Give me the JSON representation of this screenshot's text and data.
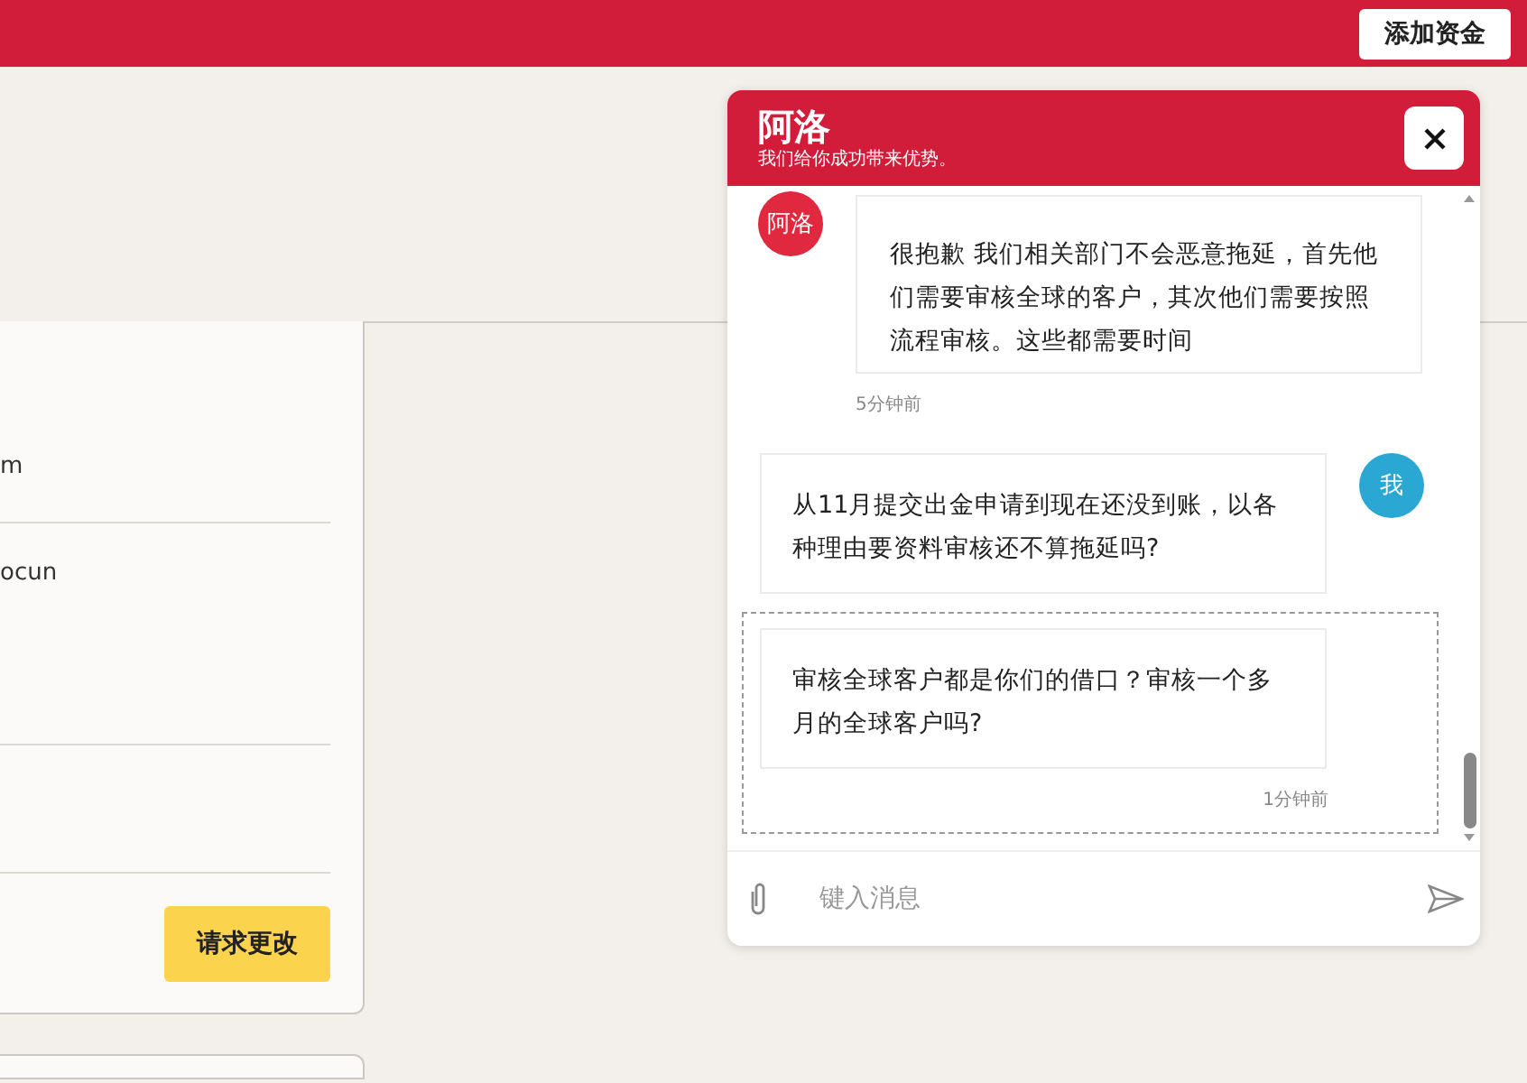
{
  "top_bar": {
    "button": "添加资金"
  },
  "card": {
    "rows": [
      {
        "text": "m"
      },
      {
        "text": "ocun"
      },
      {
        "text": ""
      }
    ],
    "button": "请求更改"
  },
  "chat": {
    "title": "阿洛",
    "subtitle": "我们给你成功带来优势。",
    "messages": [
      {
        "kind": "agent",
        "avatar": "阿洛",
        "text": "很抱歉 我们相关部门不会恶意拖延，首先他们需要审核全球的客户，其次他们需要按照流程审核。这些都需要时间",
        "time": "5分钟前",
        "highlighted": false
      },
      {
        "kind": "user",
        "avatar": "我",
        "text": "从11月提交出金申请到现在还没到账，以各种理由要资料审核还不算拖延吗?",
        "highlighted": false
      },
      {
        "kind": "user",
        "text": "审核全球客户都是你们的借口？审核一个多月的全球客户吗?",
        "time": "1分钟前",
        "highlighted": true
      }
    ],
    "input": {
      "placeholder": "键入消息"
    }
  }
}
